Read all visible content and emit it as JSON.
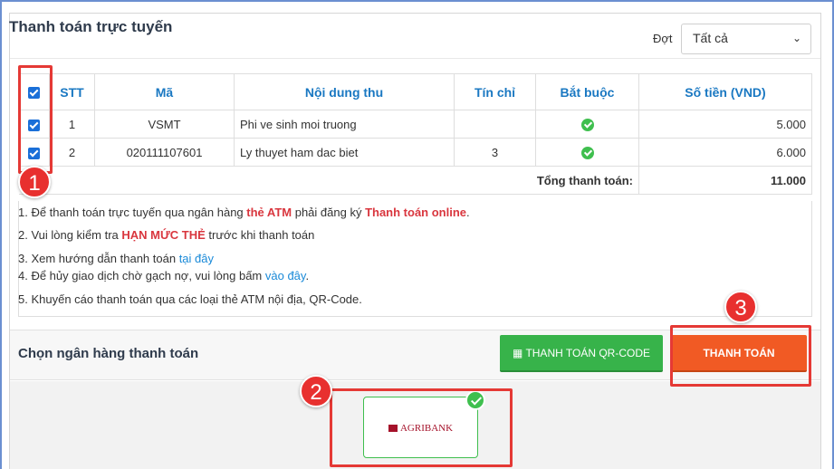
{
  "header": {
    "title": "Thanh toán trực tuyến",
    "dot_label": "Đợt",
    "dot_value": "Tất cả"
  },
  "table": {
    "columns": [
      "STT",
      "Mã",
      "Nội dung thu",
      "Tín chỉ",
      "Bắt buộc",
      "Số tiền (VND)"
    ],
    "rows": [
      {
        "stt": "1",
        "ma": "VSMT",
        "noi_dung": "Phi ve sinh moi truong",
        "tin_chi": "",
        "bat_buoc": true,
        "so_tien": "5.000",
        "checked": true
      },
      {
        "stt": "2",
        "ma": "020111107601",
        "noi_dung": "Ly thuyet ham dac biet",
        "tin_chi": "3",
        "bat_buoc": true,
        "so_tien": "6.000",
        "checked": true
      }
    ],
    "total_label": "Tổng thanh toán:",
    "total_value": "11.000"
  },
  "notes": {
    "n1_a": "1. Để thanh toán trực tuyến qua ngân hàng ",
    "n1_b": "thẻ ATM",
    "n1_c": " phải đăng ký ",
    "n1_d": "Thanh toán online",
    "n1_e": ".",
    "n2_a": "2. Vui lòng kiểm tra ",
    "n2_b": "HẠN MỨC THẺ",
    "n2_c": " trước khi thanh toán",
    "n3_a": "3. Xem hướng dẫn thanh toán ",
    "n3_b": "tại đây",
    "n4_a": "4. Để hủy giao dịch chờ gạch nợ, vui lòng bấm ",
    "n4_b": "vào đây",
    "n4_c": ".",
    "n5": "5. Khuyến cáo thanh toán qua các loại thẻ ATM nội địa, QR-Code."
  },
  "bank": {
    "title": "Chọn ngân hàng thanh toán",
    "qr_button": "THANH TOÁN QR-CODE",
    "pay_button": "THANH TOÁN",
    "selected_bank": "AGRIBANK"
  },
  "annotations": {
    "step1": "1",
    "step2": "2",
    "step3": "3"
  },
  "colors": {
    "accent_blue": "#1a78c2",
    "qr_green": "#37b34a",
    "pay_orange": "#f15a24",
    "highlight_red": "#e53935"
  }
}
